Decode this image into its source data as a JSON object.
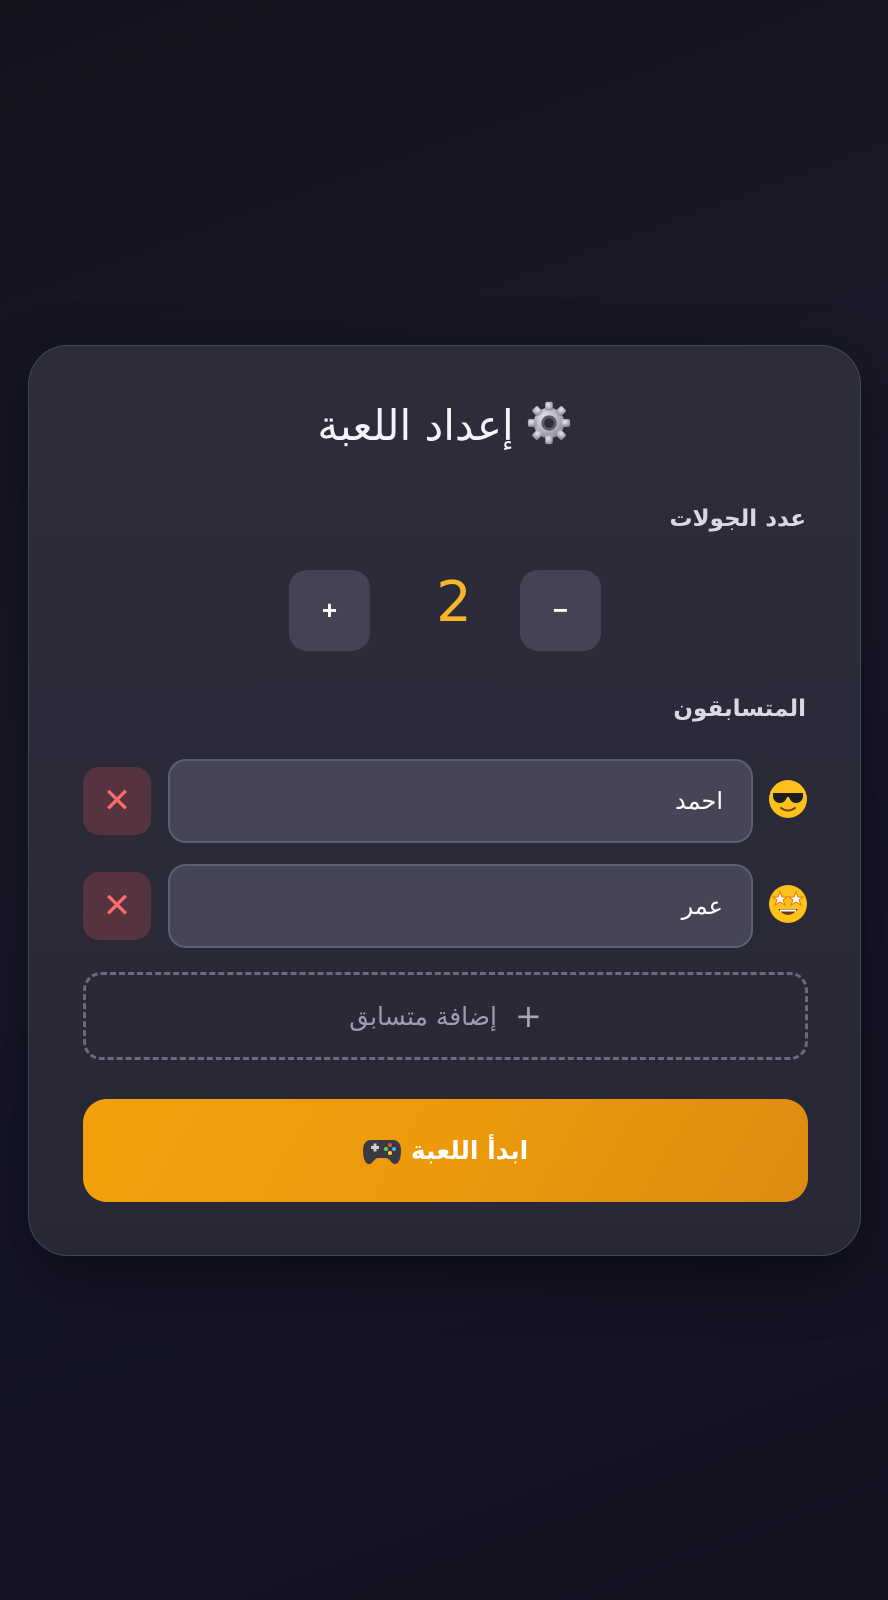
{
  "setup": {
    "title": "إعداد اللعبة",
    "title_icon": "gear-icon",
    "rounds_label": "عدد الجولات",
    "rounds_value": "2",
    "increment_label": "+",
    "decrement_label": "−",
    "players_label": "المتسابقون",
    "players": [
      {
        "name": "احمد",
        "emoji_icon": "sunglasses-face-icon",
        "remove_label": "✕"
      },
      {
        "name": "عمر",
        "emoji_icon": "star-struck-face-icon",
        "remove_label": "✕"
      }
    ],
    "add_player_label": "إضافة متسابق",
    "add_player_icon": "+",
    "start_label": "ابدأ اللعبة",
    "start_icon": "game-controller-icon"
  },
  "colors": {
    "accent": "#f3a10a",
    "rounds_value": "#f7b52a",
    "remove": "#ff6b6b",
    "card_bg": "#2c2c3b"
  }
}
